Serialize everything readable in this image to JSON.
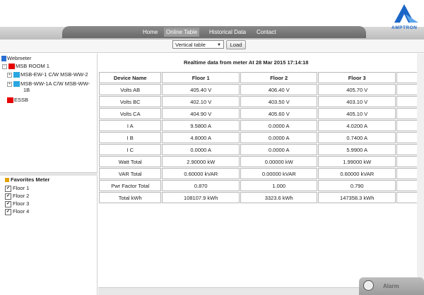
{
  "nav": {
    "items": [
      "Home",
      "Online Table",
      "Historical Data",
      "Contact"
    ],
    "active": "Online Table"
  },
  "logo": {
    "text": "AMPTRON"
  },
  "toolbar": {
    "view_select": "Vertical table",
    "load_label": "Load"
  },
  "tree": {
    "root": "Webmeter",
    "items": [
      {
        "label": "MSB ROOM 1",
        "color": "#e60000"
      },
      {
        "label": "MSB-EW-1 C/W MSB-WW-2",
        "color": "#2aa6e0"
      },
      {
        "label": "MSB-WW-1A C/W MSB-WW-",
        "label2": "1B",
        "color": "#2aa6e0"
      },
      {
        "label": "ESSB",
        "color": "#e60000"
      }
    ]
  },
  "favorites": {
    "title": "Favorites Meter",
    "items": [
      "Floor 1",
      "Floor 2",
      "Floor 3",
      "Floor 4"
    ]
  },
  "main": {
    "title": "Realtime data from meter At 28 Mar 2015 17:14:18",
    "headers": [
      "Device Name",
      "Floor 1",
      "Floor 2",
      "Floor 3"
    ],
    "rows": [
      [
        "Volts AB",
        "405.40 V",
        "406.40 V",
        "405.70 V"
      ],
      [
        "Volts BC",
        "402.10 V",
        "403.50 V",
        "403.10 V"
      ],
      [
        "Volts CA",
        "404.90 V",
        "405.60 V",
        "405.10 V"
      ],
      [
        "I A",
        "9.5800 A",
        "0.0000 A",
        "4.0200 A"
      ],
      [
        "I B",
        "4.8000 A",
        "0.0000 A",
        "0.7400 A"
      ],
      [
        "I C",
        "0.0000 A",
        "0.0000 A",
        "5.9900 A"
      ],
      [
        "Watt Total",
        "2.90000 kW",
        "0.00000 kW",
        "1.99000 kW"
      ],
      [
        "VAR Total",
        "0.60000 kVAR",
        "0.00000 kVAR",
        "0.60000 kVAR"
      ],
      [
        "Pwr Factor Total",
        "0.870",
        "1.000",
        "0.790"
      ],
      [
        "Total kWh",
        "108107.9 kWh",
        "3323.6 kWh",
        "147358.3 kWh"
      ]
    ]
  },
  "alarm": {
    "label": "Alarm"
  }
}
